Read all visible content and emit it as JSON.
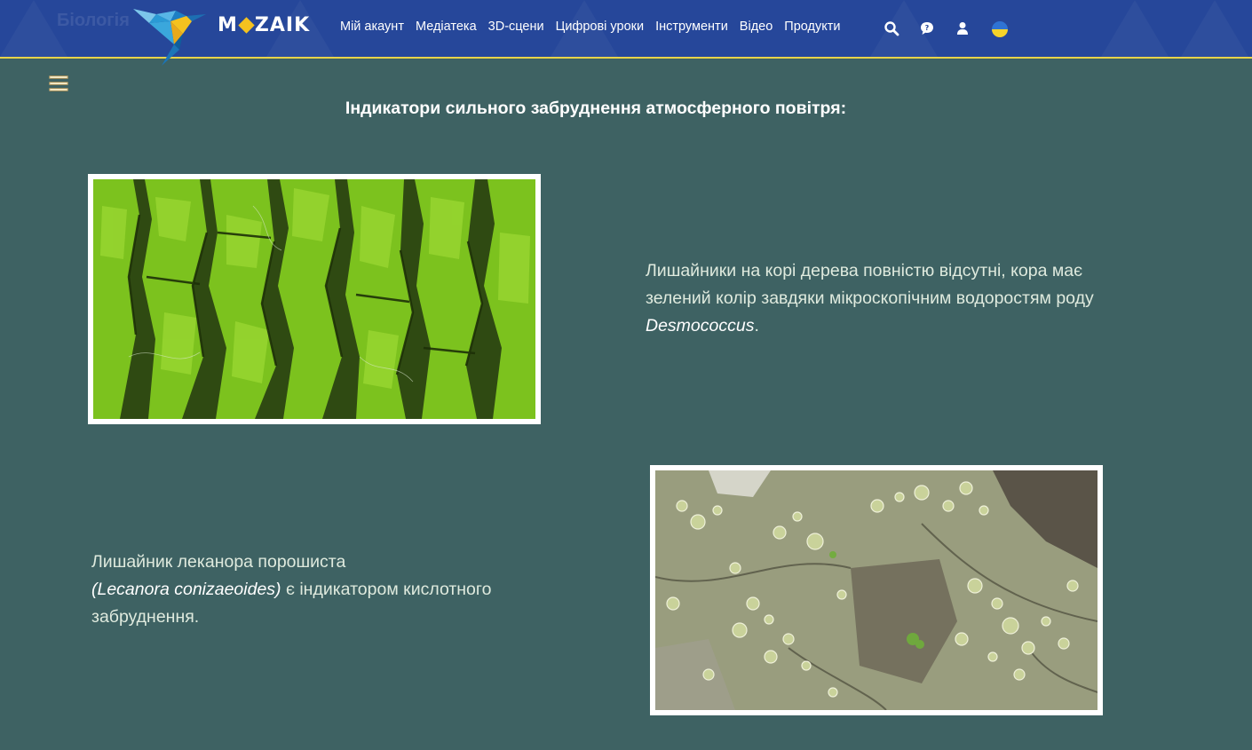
{
  "header": {
    "logo_text": [
      "M",
      "ZAIK"
    ],
    "ghost_text": "Біологія",
    "nav_items": [
      "Мій акаунт",
      "Медіатека",
      "3D-сцени",
      "Цифрові уроки",
      "Інструменти",
      "Відео",
      "Продукти"
    ],
    "icons": [
      "search-icon",
      "chat-help-icon",
      "user-icon",
      "language-flag-icon"
    ],
    "brand_color": "#26479a",
    "accent_color": "#e8d44a"
  },
  "page": {
    "title": "Індикатори сильного забруднення атмосферного повітря:",
    "background": "#3e6263"
  },
  "sections": [
    {
      "image": "green-algae-on-tree-bark",
      "caption_pre": "Лишайники на корі дерева повністю відсутні, кора має зелений колір завдяки мікроскопічним водоростям роду ",
      "caption_italic": "Desmococcus",
      "caption_post": "."
    },
    {
      "image": "lecanora-conizaeoides-lichen",
      "caption_line1": "Лишайник леканора порошиста",
      "caption_italic": "(Lecanora conizaeoides)",
      "caption_post": " є індикатором кислотного забруднення."
    }
  ]
}
